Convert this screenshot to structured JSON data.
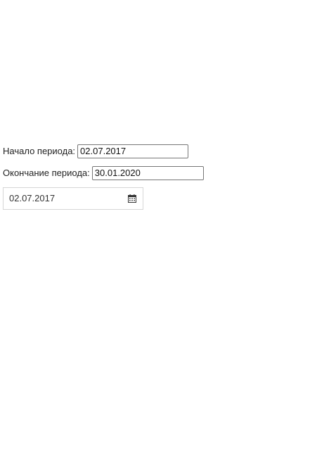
{
  "period_start": {
    "label": "Начало периода:",
    "value": "02.07.2017"
  },
  "period_end": {
    "label": "Окончание периода:",
    "value": "30.01.2020"
  },
  "datepicker": {
    "value": "02.07.2017",
    "icon": "calendar-icon"
  }
}
